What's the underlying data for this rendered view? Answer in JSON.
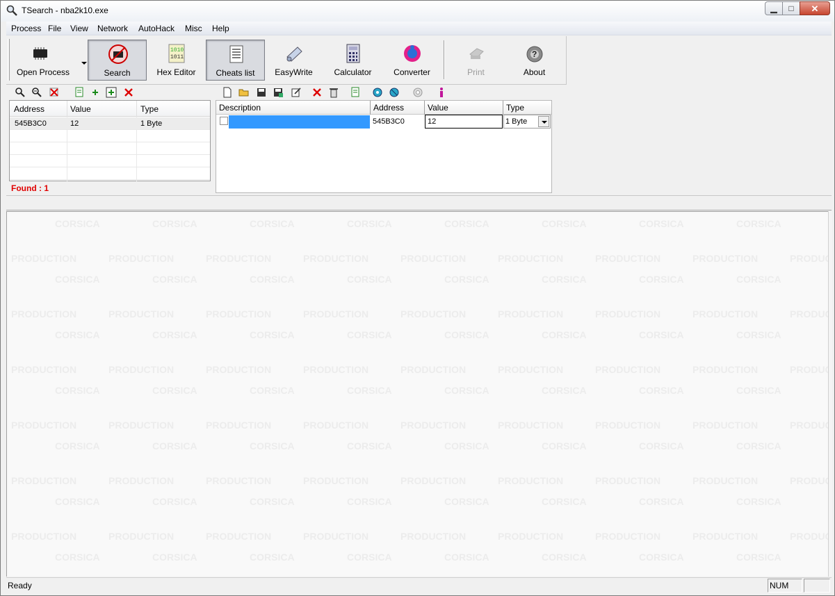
{
  "window": {
    "title": "TSearch - nba2k10.exe"
  },
  "menu": [
    "Process",
    "File",
    "View",
    "Network",
    "AutoHack",
    "Misc",
    "Help"
  ],
  "toolbar": {
    "open_process": "Open Process",
    "search": "Search",
    "hex_editor": "Hex Editor",
    "cheats_list": "Cheats list",
    "easywrite": "EasyWrite",
    "calculator": "Calculator",
    "converter": "Converter",
    "print": "Print",
    "about": "About"
  },
  "found_list": {
    "columns": [
      "Address",
      "Value",
      "Type"
    ],
    "rows": [
      [
        "545B3C0",
        "12",
        "1 Byte"
      ]
    ],
    "found_label": "Found : 1"
  },
  "cheats": {
    "columns": [
      "Description",
      "Address",
      "Value",
      "Type"
    ],
    "row": {
      "address": "545B3C0",
      "value": "12",
      "type": "1 Byte"
    }
  },
  "watermark": {
    "line1": "CORSICA",
    "line2": "PRODUCTION"
  },
  "status": {
    "text": "Ready",
    "num": "NUM"
  }
}
